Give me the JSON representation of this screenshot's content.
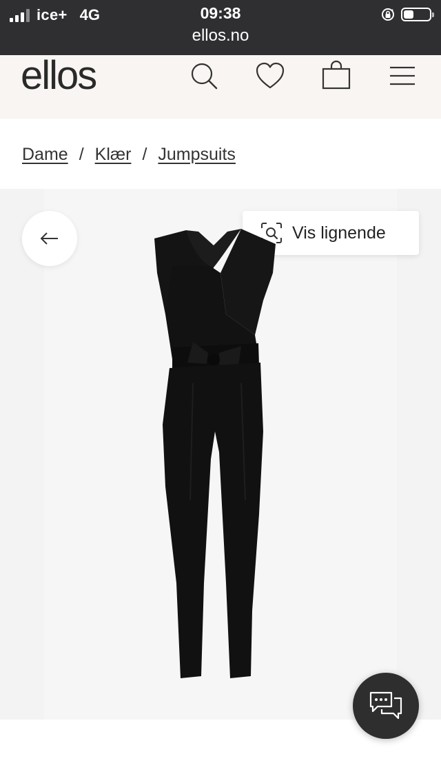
{
  "status_bar": {
    "carrier": "ice+",
    "network": "4G",
    "time": "09:38",
    "url": "ellos.no"
  },
  "header": {
    "logo": "ellos",
    "icons": [
      "search-icon",
      "heart-icon",
      "shopping-bag-icon",
      "menu-icon"
    ]
  },
  "breadcrumb": {
    "items": [
      "Dame",
      "Klær",
      "Jumpsuits"
    ],
    "separator": "/"
  },
  "gallery": {
    "similar_label": "Vis lignende",
    "back_icon": "arrow-left-icon",
    "similar_icon": "visual-search-icon",
    "product_image": "black-jumpsuit"
  },
  "chat": {
    "icon": "chat-bubbles-icon"
  },
  "colors": {
    "status_bar_bg": "#2f2f31",
    "header_bg": "#f8f5f2",
    "text": "#333333",
    "gallery_bg": "#f3f3f3",
    "chat_bg": "#2e2e2e"
  }
}
